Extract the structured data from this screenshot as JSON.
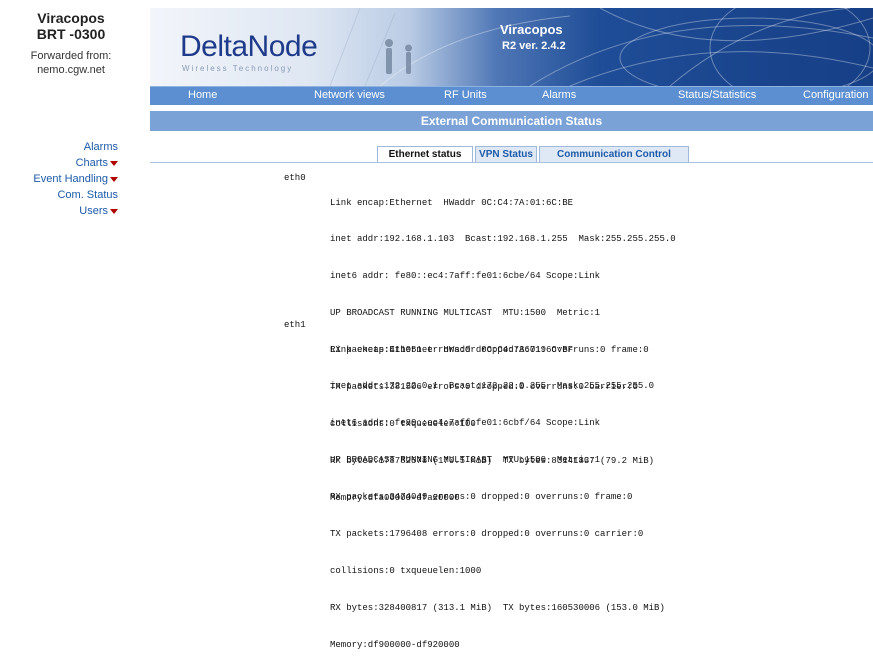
{
  "device": {
    "name": "Viracopos",
    "model": "BRT -0300",
    "forwarded_label": "Forwarded from:",
    "forwarded_host": "nemo.cgw.net"
  },
  "sidebar": {
    "items": [
      {
        "label": "Alarms",
        "has_dropdown": false
      },
      {
        "label": "Charts",
        "has_dropdown": true
      },
      {
        "label": "Event Handling",
        "has_dropdown": true
      },
      {
        "label": "Com. Status",
        "has_dropdown": false
      },
      {
        "label": "Users",
        "has_dropdown": true
      }
    ]
  },
  "banner": {
    "logo": "DeltaNode",
    "tagline": "Wireless Technology",
    "site": "Viracopos",
    "version": "R2 ver. 2.4.2"
  },
  "nav": {
    "items": [
      "Home",
      "Network views",
      "RF Units",
      "Alarms",
      "Status/Statistics",
      "Configuration"
    ]
  },
  "page": {
    "title": "External Communication Status"
  },
  "tabs": [
    {
      "label": "Ethernet status",
      "active": true
    },
    {
      "label": "VPN Status",
      "active": false
    },
    {
      "label": "Communication Control",
      "active": false
    }
  ],
  "interfaces": [
    {
      "name": "eth0",
      "lines": [
        "Link encap:Ethernet  HWaddr 0C:C4:7A:01:6C:BE",
        "inet addr:192.168.1.103  Bcast:192.168.1.255  Mask:255.255.255.0",
        "inet6 addr: fe80::ec4:7aff:fe01:6cbe/64 Scope:Link",
        "UP BROADCAST RUNNING MULTICAST  MTU:1500  Metric:1",
        "RX packets:411051 errors:0 dropped:36719 overruns:0 frame:0",
        "TX packets:381506 errors:0 dropped:0 overruns:0 carrier:0",
        "collisions:0 txqueuelen:100",
        "RX bytes:178782578 (170.5 MiB)  TX bytes:83141837 (79.2 MiB)",
        "Memory:dfa00000-dfa20000"
      ]
    },
    {
      "name": "eth1",
      "lines": [
        "Link encap:Ethernet  HWaddr 0C:C4:7A:01:6C:BF",
        "inet addr:172.22.0.1  Bcast:172.22.0.255  Mask:255.255.255.0",
        "inet6 addr: fe80::ec4:7aff:fe01:6cbf/64 Scope:Link",
        "UP BROADCAST RUNNING MULTICAST  MTU:1500  Metric:1",
        "RX packets:3474049 errors:0 dropped:0 overruns:0 frame:0",
        "TX packets:1796408 errors:0 dropped:0 overruns:0 carrier:0",
        "collisions:0 txqueuelen:1000",
        "RX bytes:328400817 (313.1 MiB)  TX bytes:160530006 (153.0 MiB)",
        "Memory:df900000-df920000"
      ]
    }
  ],
  "colors": {
    "nav_bar": "#5b8fd1",
    "title_bar": "#7aa2d6",
    "link": "#1d5aa8",
    "dropdown_arrow": "#b00000",
    "banner_dark": "#163f86"
  }
}
